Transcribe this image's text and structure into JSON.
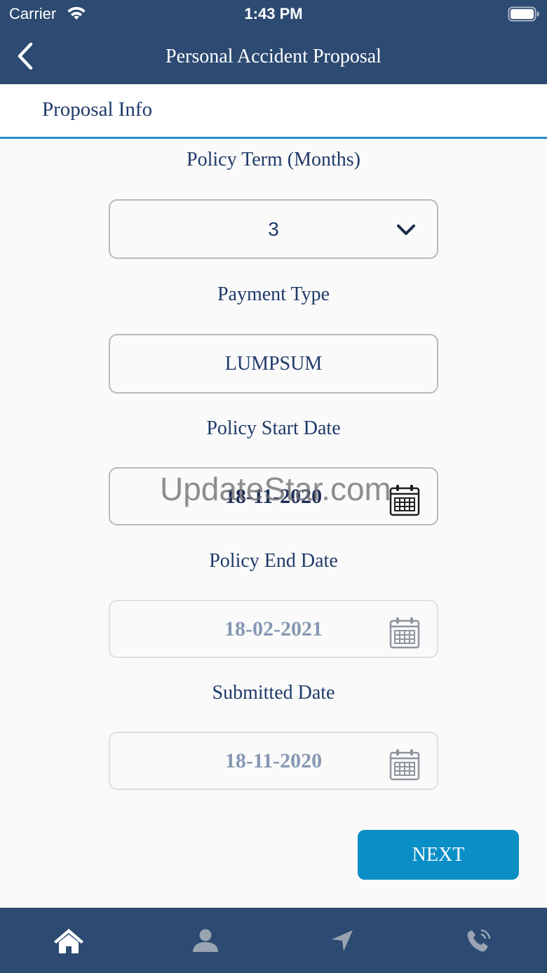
{
  "status_bar": {
    "carrier": "Carrier",
    "time": "1:43 PM",
    "wifi_icon": "wifi-icon",
    "battery_icon": "battery-icon"
  },
  "nav_bar": {
    "title": "Personal Accident Proposal",
    "back_icon": "chevron-left-icon"
  },
  "section": {
    "title": "Proposal Info"
  },
  "form": {
    "policy_term": {
      "label": "Policy Term (Months)",
      "value": "3",
      "icon": "chevron-down-icon"
    },
    "payment_type": {
      "label": "Payment Type",
      "value": "LUMPSUM"
    },
    "policy_start_date": {
      "label": "Policy Start Date",
      "value": "18-11-2020",
      "icon": "calendar-icon",
      "disabled": false
    },
    "policy_end_date": {
      "label": "Policy End Date",
      "value": "18-02-2021",
      "icon": "calendar-icon",
      "disabled": true
    },
    "submitted_date": {
      "label": "Submitted Date",
      "value": "18-11-2020",
      "icon": "calendar-icon",
      "disabled": true
    }
  },
  "next_button": {
    "label": "NEXT"
  },
  "watermark": "UpdateStar.com",
  "tab_bar": {
    "items": [
      {
        "icon": "home-icon",
        "active": true
      },
      {
        "icon": "person-icon",
        "active": false
      },
      {
        "icon": "location-arrow-icon",
        "active": false
      },
      {
        "icon": "phone-icon",
        "active": false
      }
    ]
  },
  "colors": {
    "nav_bg": "#2c4a72",
    "accent_line": "#2a8cc3",
    "button_bg": "#0a8ec6",
    "label_text": "#1f3a69",
    "value_text": "#1c2f55",
    "disabled_text": "#8698b2",
    "tab_active": "#ffffff",
    "tab_inactive": "#99a3b2",
    "body_bg": "#fafafa"
  }
}
